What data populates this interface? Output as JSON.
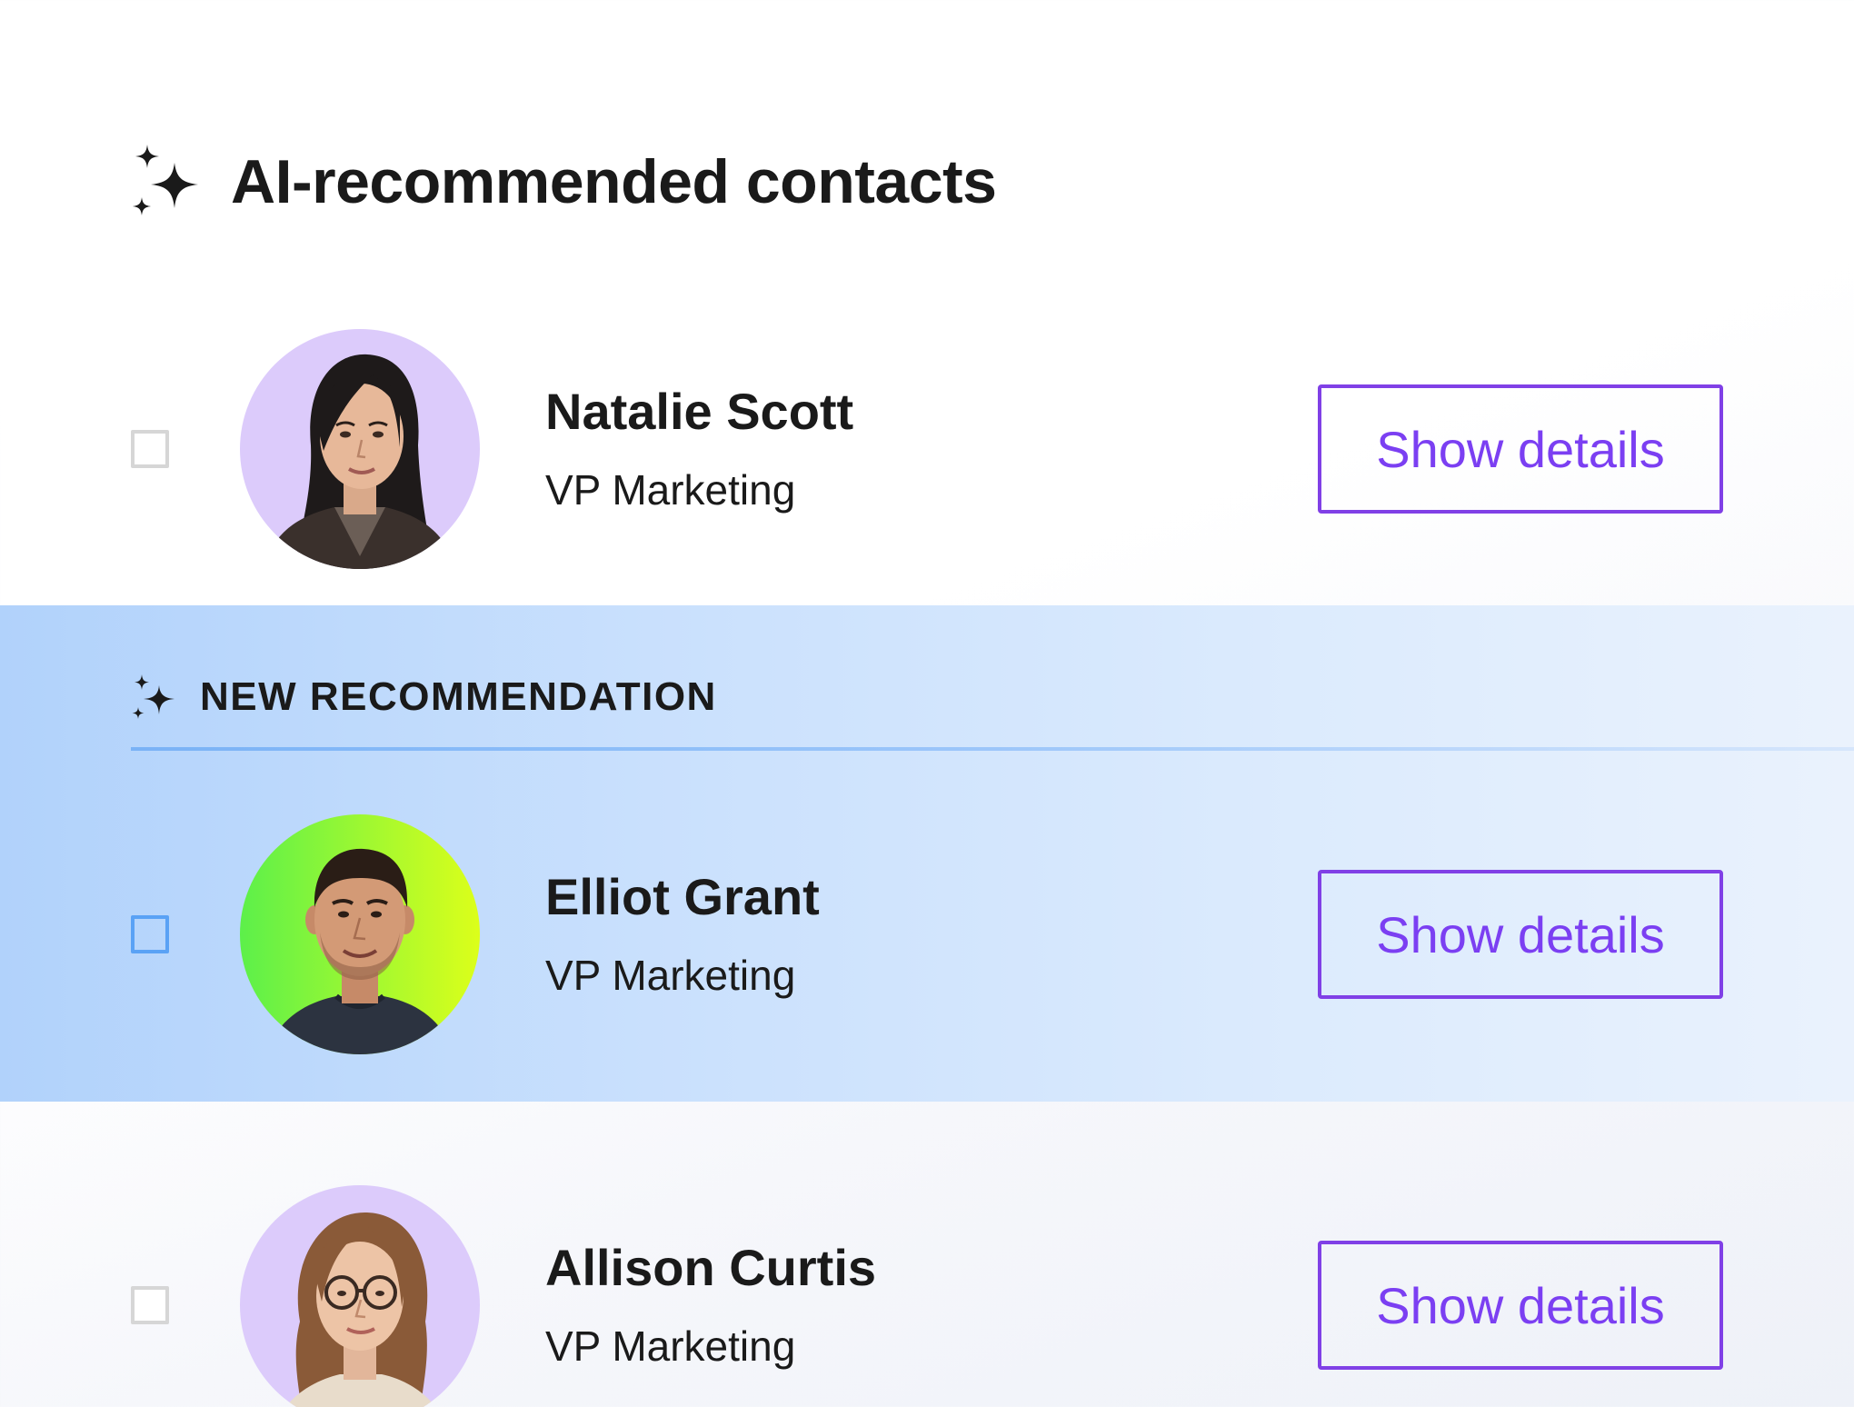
{
  "header": {
    "title": "AI-recommended contacts",
    "icon": "sparkles-icon"
  },
  "recommendation": {
    "label": "NEW RECOMMENDATION",
    "icon": "sparkles-icon"
  },
  "contacts": [
    {
      "name": "Natalie Scott",
      "role": "VP Marketing",
      "button_label": "Show details",
      "checked": false,
      "avatar_bg": "#dccbfb"
    },
    {
      "name": "Elliot Grant",
      "role": "VP Marketing",
      "button_label": "Show details",
      "checked": false,
      "avatar_bg": "#7cf04a",
      "highlighted": true
    },
    {
      "name": "Allison Curtis",
      "role": "VP Marketing",
      "button_label": "Show details",
      "checked": false,
      "avatar_bg": "#dccbfb"
    }
  ],
  "colors": {
    "accent": "#7b3ff2",
    "text": "#1a1a1a",
    "band_start": "#b1d2fb",
    "band_end": "#eaf2fd"
  }
}
